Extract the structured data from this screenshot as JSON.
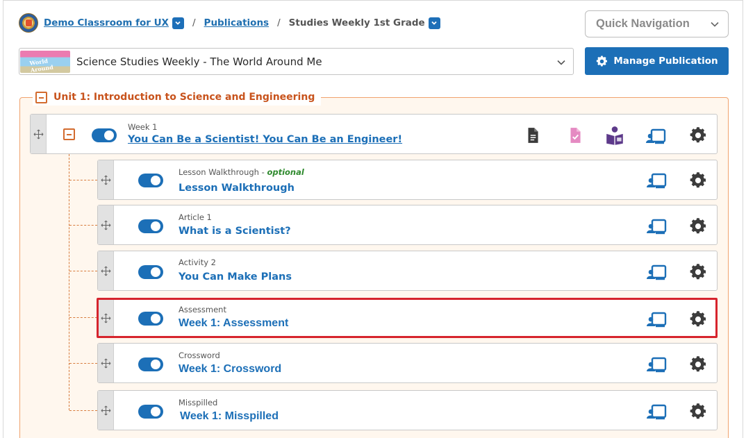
{
  "breadcrumb": {
    "classroom": "Demo Classroom for UX",
    "publications": "Publications",
    "current": "Studies Weekly 1st Grade",
    "separator": "/"
  },
  "quick_navigation": "Quick Navigation",
  "publication_select": {
    "value": "Science Studies Weekly - The World Around Me"
  },
  "manage_button": "Manage Publication",
  "unit": {
    "title": "Unit 1: Introduction to Science and Engineering"
  },
  "week": {
    "label": "Week 1",
    "title": "You Can Be a Scientist! You Can Be an Engineer!"
  },
  "items": [
    {
      "label": "Lesson Walkthrough",
      "optional_sep": " - ",
      "optional": "optional",
      "title": "Lesson Walkthrough"
    },
    {
      "label": "Article 1",
      "title": "What is a Scientist?"
    },
    {
      "label": "Activity 2",
      "title": "You Can Make Plans"
    },
    {
      "label": "Assessment",
      "title": "Week 1: Assessment"
    },
    {
      "label": "Crossword",
      "title": "Week 1: Crossword"
    },
    {
      "label": "Misspilled",
      "title": "Week 1: Misspilled"
    }
  ],
  "colors": {
    "accent": "#1c6fb7",
    "unit_orange": "#c8531c",
    "highlight": "#d6242d",
    "optional_green": "#2f8a2e"
  }
}
